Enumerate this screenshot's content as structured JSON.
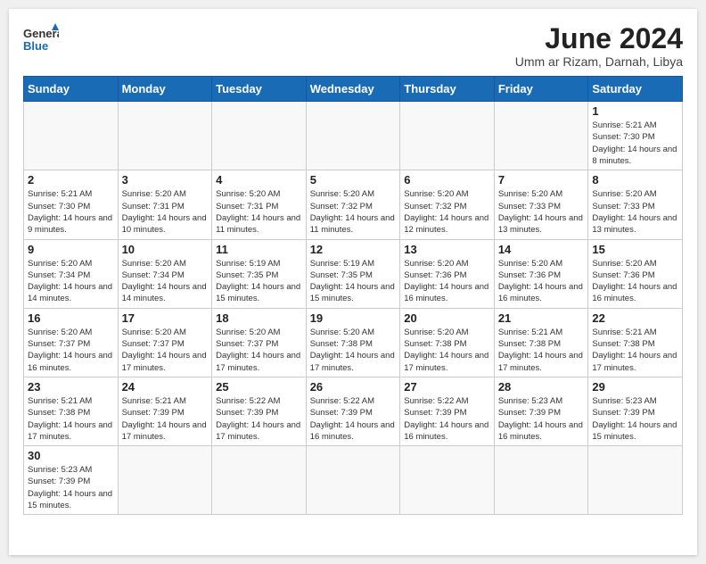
{
  "header": {
    "logo_general": "General",
    "logo_blue": "Blue",
    "month_title": "June 2024",
    "subtitle": "Umm ar Rizam, Darnah, Libya"
  },
  "weekdays": [
    "Sunday",
    "Monday",
    "Tuesday",
    "Wednesday",
    "Thursday",
    "Friday",
    "Saturday"
  ],
  "weeks": [
    [
      {
        "day": null
      },
      {
        "day": null
      },
      {
        "day": null
      },
      {
        "day": null
      },
      {
        "day": null
      },
      {
        "day": null
      },
      {
        "day": "1",
        "sunrise": "5:21 AM",
        "sunset": "7:30 PM",
        "daylight": "14 hours and 8 minutes."
      }
    ],
    [
      {
        "day": "2",
        "sunrise": "5:21 AM",
        "sunset": "7:30 PM",
        "daylight": "14 hours and 9 minutes."
      },
      {
        "day": "3",
        "sunrise": "5:20 AM",
        "sunset": "7:31 PM",
        "daylight": "14 hours and 10 minutes."
      },
      {
        "day": "4",
        "sunrise": "5:20 AM",
        "sunset": "7:31 PM",
        "daylight": "14 hours and 11 minutes."
      },
      {
        "day": "5",
        "sunrise": "5:20 AM",
        "sunset": "7:32 PM",
        "daylight": "14 hours and 11 minutes."
      },
      {
        "day": "6",
        "sunrise": "5:20 AM",
        "sunset": "7:32 PM",
        "daylight": "14 hours and 12 minutes."
      },
      {
        "day": "7",
        "sunrise": "5:20 AM",
        "sunset": "7:33 PM",
        "daylight": "14 hours and 13 minutes."
      },
      {
        "day": "8",
        "sunrise": "5:20 AM",
        "sunset": "7:33 PM",
        "daylight": "14 hours and 13 minutes."
      }
    ],
    [
      {
        "day": "9",
        "sunrise": "5:20 AM",
        "sunset": "7:34 PM",
        "daylight": "14 hours and 14 minutes."
      },
      {
        "day": "10",
        "sunrise": "5:20 AM",
        "sunset": "7:34 PM",
        "daylight": "14 hours and 14 minutes."
      },
      {
        "day": "11",
        "sunrise": "5:19 AM",
        "sunset": "7:35 PM",
        "daylight": "14 hours and 15 minutes."
      },
      {
        "day": "12",
        "sunrise": "5:19 AM",
        "sunset": "7:35 PM",
        "daylight": "14 hours and 15 minutes."
      },
      {
        "day": "13",
        "sunrise": "5:20 AM",
        "sunset": "7:36 PM",
        "daylight": "14 hours and 16 minutes."
      },
      {
        "day": "14",
        "sunrise": "5:20 AM",
        "sunset": "7:36 PM",
        "daylight": "14 hours and 16 minutes."
      },
      {
        "day": "15",
        "sunrise": "5:20 AM",
        "sunset": "7:36 PM",
        "daylight": "14 hours and 16 minutes."
      }
    ],
    [
      {
        "day": "16",
        "sunrise": "5:20 AM",
        "sunset": "7:37 PM",
        "daylight": "14 hours and 16 minutes."
      },
      {
        "day": "17",
        "sunrise": "5:20 AM",
        "sunset": "7:37 PM",
        "daylight": "14 hours and 17 minutes."
      },
      {
        "day": "18",
        "sunrise": "5:20 AM",
        "sunset": "7:37 PM",
        "daylight": "14 hours and 17 minutes."
      },
      {
        "day": "19",
        "sunrise": "5:20 AM",
        "sunset": "7:38 PM",
        "daylight": "14 hours and 17 minutes."
      },
      {
        "day": "20",
        "sunrise": "5:20 AM",
        "sunset": "7:38 PM",
        "daylight": "14 hours and 17 minutes."
      },
      {
        "day": "21",
        "sunrise": "5:21 AM",
        "sunset": "7:38 PM",
        "daylight": "14 hours and 17 minutes."
      },
      {
        "day": "22",
        "sunrise": "5:21 AM",
        "sunset": "7:38 PM",
        "daylight": "14 hours and 17 minutes."
      }
    ],
    [
      {
        "day": "23",
        "sunrise": "5:21 AM",
        "sunset": "7:38 PM",
        "daylight": "14 hours and 17 minutes."
      },
      {
        "day": "24",
        "sunrise": "5:21 AM",
        "sunset": "7:39 PM",
        "daylight": "14 hours and 17 minutes."
      },
      {
        "day": "25",
        "sunrise": "5:22 AM",
        "sunset": "7:39 PM",
        "daylight": "14 hours and 17 minutes."
      },
      {
        "day": "26",
        "sunrise": "5:22 AM",
        "sunset": "7:39 PM",
        "daylight": "14 hours and 16 minutes."
      },
      {
        "day": "27",
        "sunrise": "5:22 AM",
        "sunset": "7:39 PM",
        "daylight": "14 hours and 16 minutes."
      },
      {
        "day": "28",
        "sunrise": "5:23 AM",
        "sunset": "7:39 PM",
        "daylight": "14 hours and 16 minutes."
      },
      {
        "day": "29",
        "sunrise": "5:23 AM",
        "sunset": "7:39 PM",
        "daylight": "14 hours and 15 minutes."
      }
    ],
    [
      {
        "day": "30",
        "sunrise": "5:23 AM",
        "sunset": "7:39 PM",
        "daylight": "14 hours and 15 minutes."
      },
      {
        "day": null
      },
      {
        "day": null
      },
      {
        "day": null
      },
      {
        "day": null
      },
      {
        "day": null
      },
      {
        "day": null
      }
    ]
  ],
  "labels": {
    "sunrise": "Sunrise:",
    "sunset": "Sunset:",
    "daylight": "Daylight:"
  }
}
